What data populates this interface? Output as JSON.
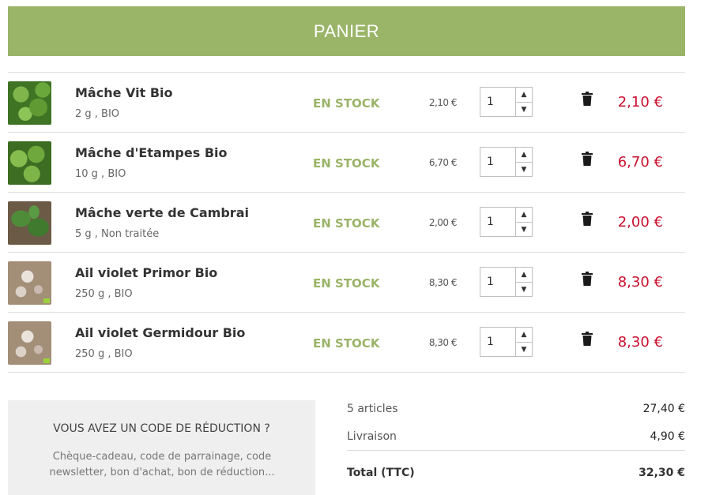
{
  "header": {
    "title": "PANIER"
  },
  "cart": {
    "items": [
      {
        "name": "Mâche Vit Bio",
        "details": "2 g , BIO",
        "stock": "EN STOCK",
        "unit_price": "2,10 €",
        "quantity": "1",
        "line_total": "2,10 €",
        "image": "mache-image"
      },
      {
        "name": "Mâche d'Etampes Bio",
        "details": "10 g , BIO",
        "stock": "EN STOCK",
        "unit_price": "6,70 €",
        "quantity": "1",
        "line_total": "6,70 €",
        "image": "mache-image"
      },
      {
        "name": "Mâche verte de Cambrai",
        "details": "5 g , Non traitée",
        "stock": "EN STOCK",
        "unit_price": "2,00 €",
        "quantity": "1",
        "line_total": "2,00 €",
        "image": "mache-image"
      },
      {
        "name": "Ail violet Primor Bio",
        "details": "250 g , BIO",
        "stock": "EN STOCK",
        "unit_price": "8,30 €",
        "quantity": "1",
        "line_total": "8,30 €",
        "image": "garlic-image"
      },
      {
        "name": "Ail violet Germidour Bio",
        "details": "250 g , BIO",
        "stock": "EN STOCK",
        "unit_price": "8,30 €",
        "quantity": "1",
        "line_total": "8,30 €",
        "image": "garlic-image"
      }
    ]
  },
  "promo": {
    "title": "VOUS AVEZ UN CODE DE RÉDUCTION ?",
    "description": "Chèque-cadeau, code de parrainage, code newsletter, bon d'achat, bon de réduction..."
  },
  "summary": {
    "articles_label": "5 articles",
    "articles_value": "27,40 €",
    "shipping_label": "Livraison",
    "shipping_value": "4,90 €",
    "total_label": "Total (TTC)",
    "total_value": "32,30 €"
  },
  "colors": {
    "accent": "#9ab468",
    "price": "#c8102e",
    "promo_bg": "#efefef"
  }
}
